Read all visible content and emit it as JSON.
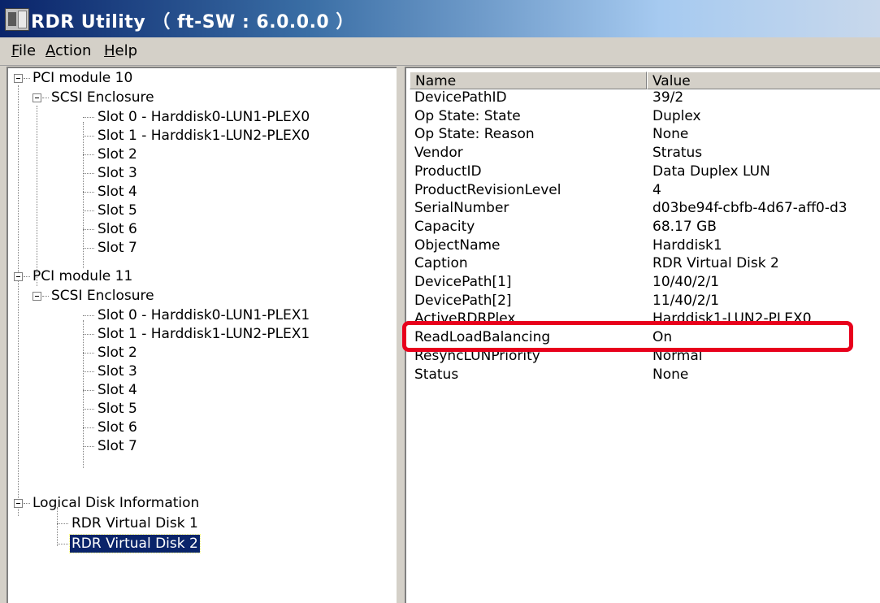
{
  "window": {
    "title": "RDR Utility （ ft-SW : 6.0.0.0 ）",
    "highlight_color": "#e8001c",
    "selection_color": "#0a246a"
  },
  "menu": {
    "file": {
      "underline": "F",
      "rest": "ile"
    },
    "action": {
      "underline": "A",
      "rest": "ction"
    },
    "help": {
      "underline": "H",
      "rest": "elp"
    }
  },
  "tree": {
    "pci10": "PCI module 10",
    "pci10_enclosure": "SCSI Enclosure",
    "pci10_slots": [
      "Slot 0  -  Harddisk0-LUN1-PLEX0",
      "Slot 1  -  Harddisk1-LUN2-PLEX0",
      "Slot 2",
      "Slot 3",
      "Slot 4",
      "Slot 5",
      "Slot 6",
      "Slot 7"
    ],
    "pci11": "PCI module 11",
    "pci11_enclosure": "SCSI Enclosure",
    "pci11_slots": [
      "Slot 0  -  Harddisk0-LUN1-PLEX1",
      "Slot 1  -  Harddisk1-LUN2-PLEX1",
      "Slot 2",
      "Slot 3",
      "Slot 4",
      "Slot 5",
      "Slot 6",
      "Slot 7"
    ],
    "logical": "Logical Disk Information",
    "disks": [
      "RDR Virtual Disk 1",
      "RDR Virtual Disk 2"
    ],
    "selected": "RDR Virtual Disk 2"
  },
  "list": {
    "headers": [
      "Name",
      "Value"
    ],
    "rows": [
      {
        "name": "DevicePathID",
        "value": "39/2"
      },
      {
        "name": "Op State: State",
        "value": "Duplex"
      },
      {
        "name": "Op State: Reason",
        "value": "None"
      },
      {
        "name": "Vendor",
        "value": "Stratus"
      },
      {
        "name": "ProductID",
        "value": "Data Duplex LUN"
      },
      {
        "name": "ProductRevisionLevel",
        "value": "4"
      },
      {
        "name": "SerialNumber",
        "value": "d03be94f-cbfb-4d67-aff0-d3"
      },
      {
        "name": "Capacity",
        "value": "68.17 GB"
      },
      {
        "name": "ObjectName",
        "value": "Harddisk1"
      },
      {
        "name": "Caption",
        "value": "RDR Virtual Disk 2"
      },
      {
        "name": "DevicePath[1]",
        "value": "10/40/2/1"
      },
      {
        "name": "DevicePath[2]",
        "value": "11/40/2/1"
      },
      {
        "name": "ActiveRDRPlex",
        "value": "Harddisk1-LUN2-PLEX0"
      },
      {
        "name": "ReadLoadBalancing",
        "value": "On"
      },
      {
        "name": "ResyncLUNPriority",
        "value": "Normal"
      },
      {
        "name": "Status",
        "value": "None"
      }
    ]
  }
}
